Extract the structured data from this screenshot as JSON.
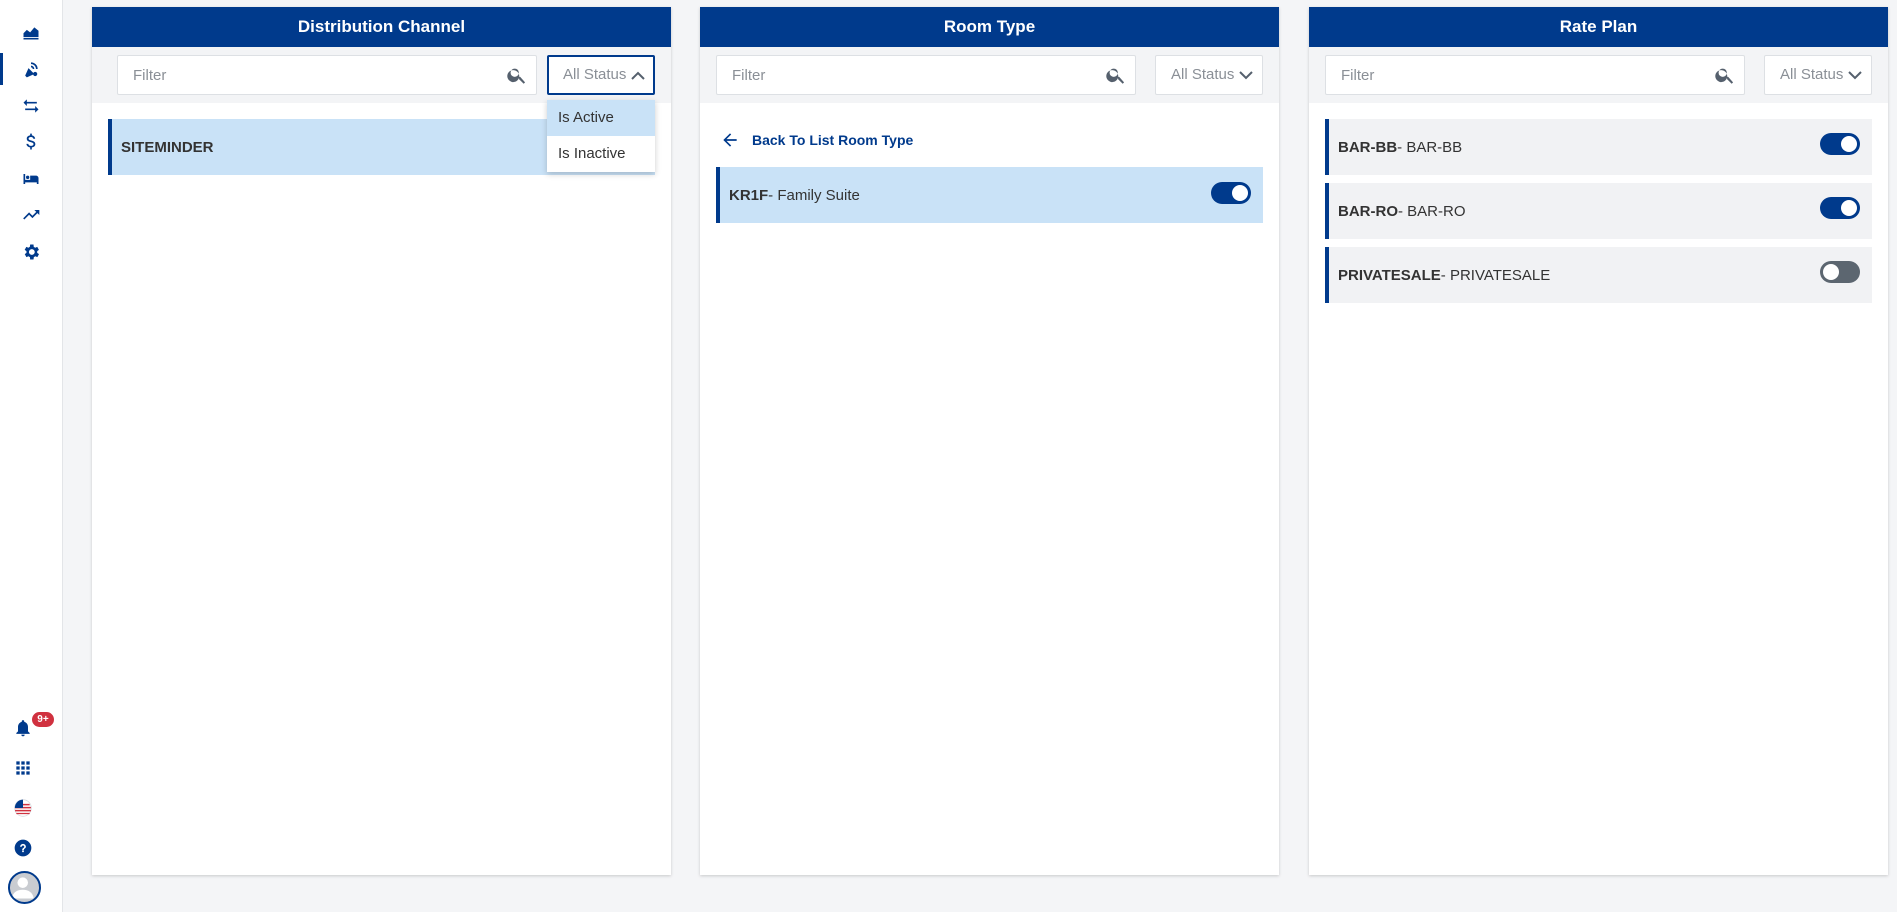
{
  "sidebar": {
    "items": [
      {
        "icon": "area-chart-icon"
      },
      {
        "icon": "satellite-dish-icon"
      },
      {
        "icon": "swap-arrows-icon"
      },
      {
        "icon": "dollar-icon"
      },
      {
        "icon": "bed-icon"
      },
      {
        "icon": "trending-up-icon"
      },
      {
        "icon": "gear-icon"
      }
    ],
    "notifications_badge": "9+",
    "bottom_icons": [
      "bell-icon",
      "apps-grid-icon",
      "us-flag-icon",
      "help-icon",
      "avatar"
    ]
  },
  "distribution_channel": {
    "title": "Distribution Channel",
    "filter_placeholder": "Filter",
    "status_label": "All Status",
    "status_options": [
      "Is Active",
      "Is Inactive"
    ],
    "items": [
      {
        "label": "SITEMINDER"
      }
    ]
  },
  "room_type": {
    "title": "Room Type",
    "filter_placeholder": "Filter",
    "status_label": "All Status",
    "back_label": "Back To List Room Type",
    "items": [
      {
        "code": "KR1F",
        "name": "- Family Suite",
        "active": true
      }
    ]
  },
  "rate_plan": {
    "title": "Rate Plan",
    "filter_placeholder": "Filter",
    "status_label": "All Status",
    "items": [
      {
        "code": "BAR-BB",
        "name": "- BAR-BB",
        "active": true
      },
      {
        "code": "BAR-RO",
        "name": "- BAR-RO",
        "active": true
      },
      {
        "code": "PRIVATESALE",
        "name": "- PRIVATESALE",
        "active": false
      }
    ]
  },
  "colors": {
    "primary": "#003a8c",
    "selected_row": "#c9e2f7",
    "row_bg": "#f1f2f4",
    "badge": "#d0313f",
    "toggle_off": "#5c6670"
  }
}
